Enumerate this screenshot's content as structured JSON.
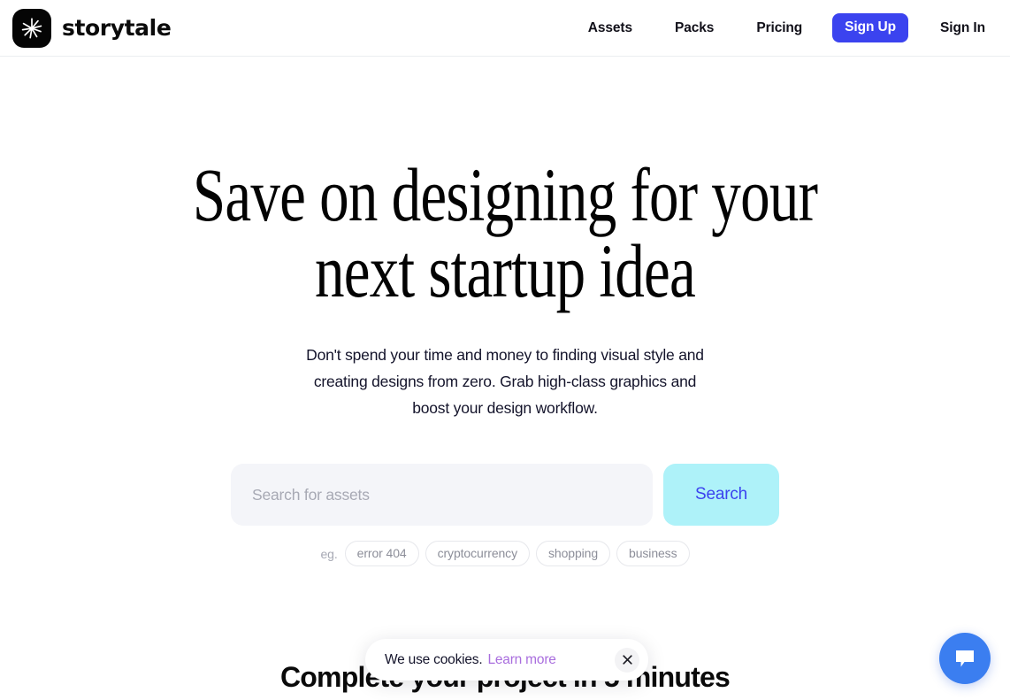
{
  "header": {
    "logo_icon": "starburst-icon",
    "brand_name": "storytale",
    "nav": [
      {
        "label": "Assets"
      },
      {
        "label": "Packs"
      },
      {
        "label": "Pricing"
      }
    ],
    "sign_up_label": "Sign Up",
    "sign_in_label": "Sign In"
  },
  "hero": {
    "title": "Save on designing for your\nnext startup idea",
    "subtitle": "Don't spend your time and money to finding visual style and creating designs from zero. Grab high-class graphics and boost your design workflow."
  },
  "search": {
    "placeholder": "Search for assets",
    "value": "",
    "button_label": "Search",
    "tags_label": "eg.",
    "tags": [
      {
        "label": "error 404"
      },
      {
        "label": "cryptocurrency"
      },
      {
        "label": "shopping"
      },
      {
        "label": "business"
      }
    ]
  },
  "section": {
    "title": "Complete your project in 5 minutes"
  },
  "cookie_banner": {
    "text": "We use cookies.",
    "link_label": "Learn more",
    "close_icon": "close-icon"
  },
  "chat": {
    "icon": "chat-bubble-icon"
  },
  "colors": {
    "accent_blue": "#3b43ef",
    "search_button_bg": "#aef2f9",
    "search_input_bg": "#f4f5f9",
    "link_purple": "#a96ede",
    "chat_blue": "#3b7ef0",
    "page_bg": "#ffffff"
  }
}
